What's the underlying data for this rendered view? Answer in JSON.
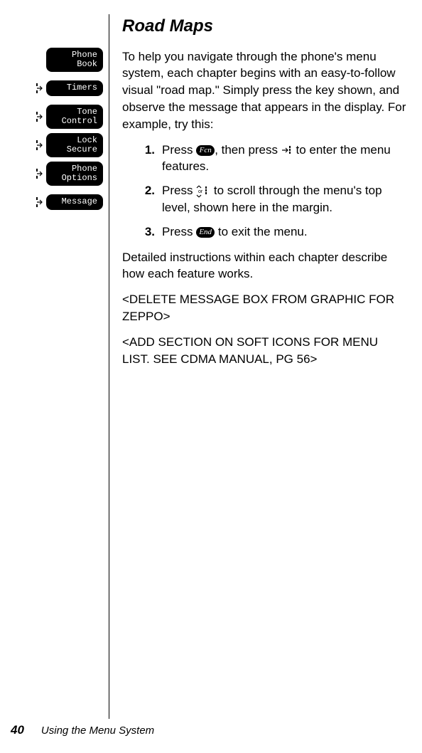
{
  "heading": "Road Maps",
  "intro": "To help you navigate through the phone's menu system, each chapter begins with an easy-to-follow visual \"road map.\" Simply press the key shown, and observe the message that appears in the display. For example, try this:",
  "steps": {
    "s1": {
      "num": "1.",
      "a": "Press ",
      "key": "Fcn",
      "b": ", then press ",
      "c": " to enter the menu features."
    },
    "s2": {
      "num": "2.",
      "a": "Press  ",
      "b": " to scroll through the menu's top level, shown here in the margin."
    },
    "s3": {
      "num": "3.",
      "a": "Press ",
      "key": "End",
      "b": " to exit the menu."
    }
  },
  "detail": "Detailed instructions within each chapter describe how each feature works.",
  "note1": "<DELETE MESSAGE BOX FROM GRAPHIC FOR ZEPPO>",
  "note2": "<ADD SECTION ON SOFT ICONS FOR MENU LIST. SEE CDMA MANUAL, PG 56>",
  "menu": {
    "m1": "Phone\nBook",
    "m2": "Timers",
    "m3": "Tone\nControl",
    "m4": "Lock\nSecure",
    "m5": "Phone\nOptions",
    "m6": "Message"
  },
  "footer": {
    "page": "40",
    "title": "Using the Menu System"
  }
}
